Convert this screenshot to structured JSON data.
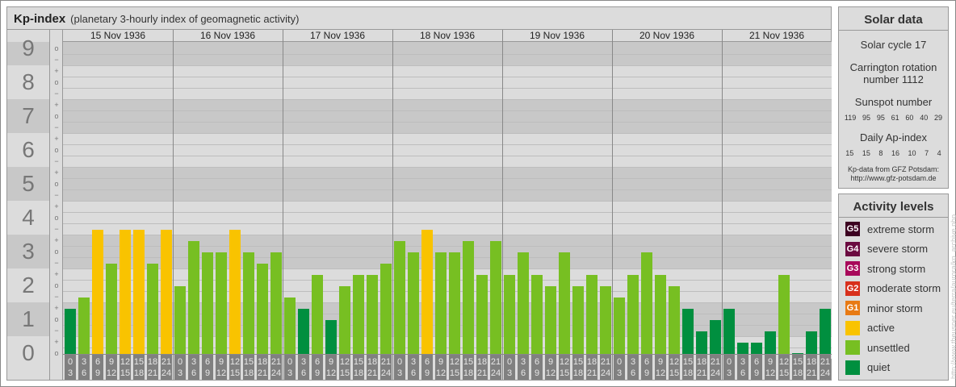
{
  "header": {
    "title": "Kp-index",
    "subtitle": "(planetary 3-hourly index of geomagnetic activity)"
  },
  "chart_data": {
    "type": "bar",
    "title": "Kp-index",
    "ylim": [
      0,
      9
    ],
    "y_ticks": [
      "0",
      "1",
      "2",
      "3",
      "4",
      "5",
      "6",
      "7",
      "8",
      "9"
    ],
    "sub_ticks": {
      "minus": "−",
      "zero": "o",
      "plus": "+"
    },
    "days": [
      "15 Nov 1936",
      "16 Nov 1936",
      "17 Nov 1936",
      "18 Nov 1936",
      "19 Nov 1936",
      "20 Nov 1936",
      "21 Nov 1936"
    ],
    "slots": [
      [
        "0",
        "3"
      ],
      [
        "3",
        "6"
      ],
      [
        "6",
        "9"
      ],
      [
        "9",
        "12"
      ],
      [
        "12",
        "15"
      ],
      [
        "15",
        "18"
      ],
      [
        "18",
        "21"
      ],
      [
        "21",
        "24"
      ]
    ],
    "series": [
      {
        "day": "15 Nov 1936",
        "values": [
          1.33,
          1.67,
          3.67,
          2.67,
          3.67,
          3.67,
          2.67,
          3.67
        ]
      },
      {
        "day": "16 Nov 1936",
        "values": [
          2,
          3.33,
          3,
          3,
          3.67,
          3,
          2.67,
          3
        ]
      },
      {
        "day": "17 Nov 1936",
        "values": [
          1.67,
          1.33,
          2.33,
          1,
          2,
          2.33,
          2.33,
          2.67
        ]
      },
      {
        "day": "18 Nov 1936",
        "values": [
          3.33,
          3,
          3.67,
          3,
          3,
          3.33,
          2.33,
          3.33
        ]
      },
      {
        "day": "19 Nov 1936",
        "values": [
          2.33,
          3,
          2.33,
          2,
          3,
          2,
          2.33,
          2
        ]
      },
      {
        "day": "20 Nov 1936",
        "values": [
          1.67,
          2.33,
          3,
          2.33,
          2,
          1.33,
          0.67,
          1
        ]
      },
      {
        "day": "21 Nov 1936",
        "values": [
          1.33,
          0.33,
          0.33,
          0.67,
          2.33,
          0,
          0.67,
          1.33
        ]
      }
    ],
    "colors": {
      "quiet": "#008f3f",
      "unsettled": "#77bf22",
      "active": "#f9c300"
    }
  },
  "solar": {
    "title": "Solar data",
    "cycle": "Solar cycle 17",
    "carrington_1": "Carrington rotation",
    "carrington_2": "number 1112",
    "sunspot_label": "Sunspot number",
    "sunspots": [
      "119",
      "95",
      "95",
      "61",
      "60",
      "40",
      "29"
    ],
    "ap_label": "Daily Ap-index",
    "ap": [
      "15",
      "15",
      "8",
      "16",
      "10",
      "7",
      "4"
    ],
    "source_1": "Kp-data from GFZ Potsdam:",
    "source_2": "http://www.gfz-potsdam.de"
  },
  "legend": {
    "title": "Activity levels",
    "items": [
      {
        "badge": "G5",
        "label": "extreme storm",
        "color": "#3c0020"
      },
      {
        "badge": "G4",
        "label": "severe storm",
        "color": "#6b0a40"
      },
      {
        "badge": "G3",
        "label": "strong storm",
        "color": "#a8085a"
      },
      {
        "badge": "G2",
        "label": "moderate storm",
        "color": "#d8301c"
      },
      {
        "badge": "G1",
        "label": "minor storm",
        "color": "#e87a14"
      },
      {
        "badge": "",
        "label": "active",
        "color": "#f9c300"
      },
      {
        "badge": "",
        "label": "unsettled",
        "color": "#77bf22"
      },
      {
        "badge": "",
        "label": "quiet",
        "color": "#008f3f"
      }
    ]
  },
  "watermark": "http://www.theusner.eu/terra/aurora/kp_archive.php"
}
